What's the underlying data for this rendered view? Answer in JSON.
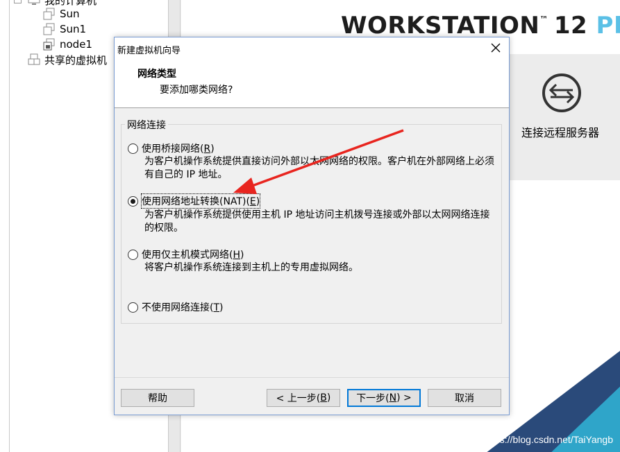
{
  "library": {
    "items": [
      {
        "label": "我的计算机"
      },
      {
        "label": "Sun"
      },
      {
        "label": "Sun1"
      },
      {
        "label": "node1"
      },
      {
        "label": "共享的虚拟机"
      }
    ]
  },
  "home": {
    "brand": {
      "main": "WORKSTATION",
      "tm": "™",
      "version": "12",
      "edition": "PRO"
    },
    "remote_label": "连接远程服务器",
    "watermark": "https://blog.csdn.net/TaiYangb"
  },
  "dialog": {
    "title": "新建虚拟机向导",
    "header_title": "网络类型",
    "header_subtitle": "要添加哪类网络?",
    "group_label": "网络连接",
    "options": [
      {
        "label_pre": "使用桥接网络(",
        "key": "R",
        "label_post": ")",
        "desc": "为客户机操作系统提供直接访问外部以太网网络的权限。客户机在外部网络上必须有自己的 IP 地址。",
        "checked": false
      },
      {
        "label_pre": "使用网络地址转换(NAT)(",
        "key": "E",
        "label_post": ")",
        "desc": "为客户机操作系统提供使用主机 IP 地址访问主机拨号连接或外部以太网网络连接的权限。",
        "checked": true
      },
      {
        "label_pre": "使用仅主机模式网络(",
        "key": "H",
        "label_post": ")",
        "desc": "将客户机操作系统连接到主机上的专用虚拟网络。",
        "checked": false
      },
      {
        "label_pre": "不使用网络连接(",
        "key": "T",
        "label_post": ")",
        "desc": "",
        "checked": false
      }
    ],
    "buttons": {
      "help": "帮助",
      "back_pre": "< 上一步(",
      "back_key": "B",
      "back_post": ")",
      "next_pre": "下一步(",
      "next_key": "N",
      "next_post": ") >",
      "cancel": "取消"
    }
  },
  "colors": {
    "accent": "#0078d7",
    "arrow": "#e8251f",
    "brand_pro": "#5bc0e6"
  }
}
